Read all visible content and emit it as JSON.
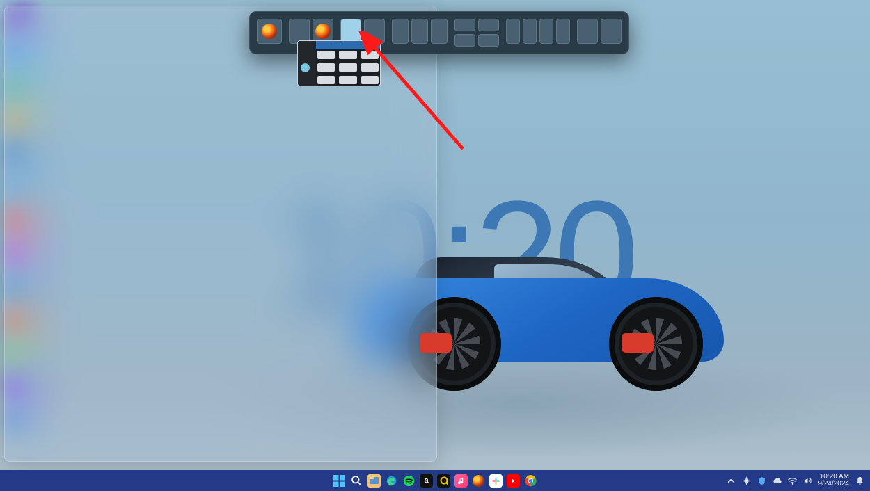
{
  "wallpaper": {
    "clock": "10:20"
  },
  "snap_picker": {
    "layouts": [
      {
        "id": "full",
        "app": "firefox"
      },
      {
        "id": "half-half",
        "app": "firefox"
      },
      {
        "id": "half-half-b",
        "active_cell": 0
      },
      {
        "id": "thirds"
      },
      {
        "id": "quad"
      },
      {
        "id": "quarters"
      },
      {
        "id": "half-half-c"
      }
    ]
  },
  "candidate_window": {
    "app": "file-explorer"
  },
  "taskbar": {
    "apps": [
      {
        "name": "start",
        "color": "#4cc2ff"
      },
      {
        "name": "search",
        "color": "#f3c14b"
      },
      {
        "name": "file-explorer",
        "color": "#f0c276"
      },
      {
        "name": "edge",
        "color": "#3da9d9"
      },
      {
        "name": "spotify",
        "color": "#1ed760"
      },
      {
        "name": "app-a",
        "color": "#111"
      },
      {
        "name": "app-q",
        "color": "#f1c40f"
      },
      {
        "name": "music",
        "color": "#e74c3c"
      },
      {
        "name": "firefox",
        "color": "#ff7b1f"
      },
      {
        "name": "slack",
        "color": "#e8e8e8"
      },
      {
        "name": "youtube",
        "color": "#ff0000"
      },
      {
        "name": "chrome",
        "color": "#ffffff"
      }
    ],
    "systray": {
      "icons": [
        "chevron-up",
        "sparkle",
        "shield",
        "cloud",
        "wifi",
        "volume"
      ],
      "time": "10:20 AM",
      "date": "9/24/2024"
    }
  },
  "annotation": {
    "type": "arrow",
    "color": "#ff1a1a"
  }
}
